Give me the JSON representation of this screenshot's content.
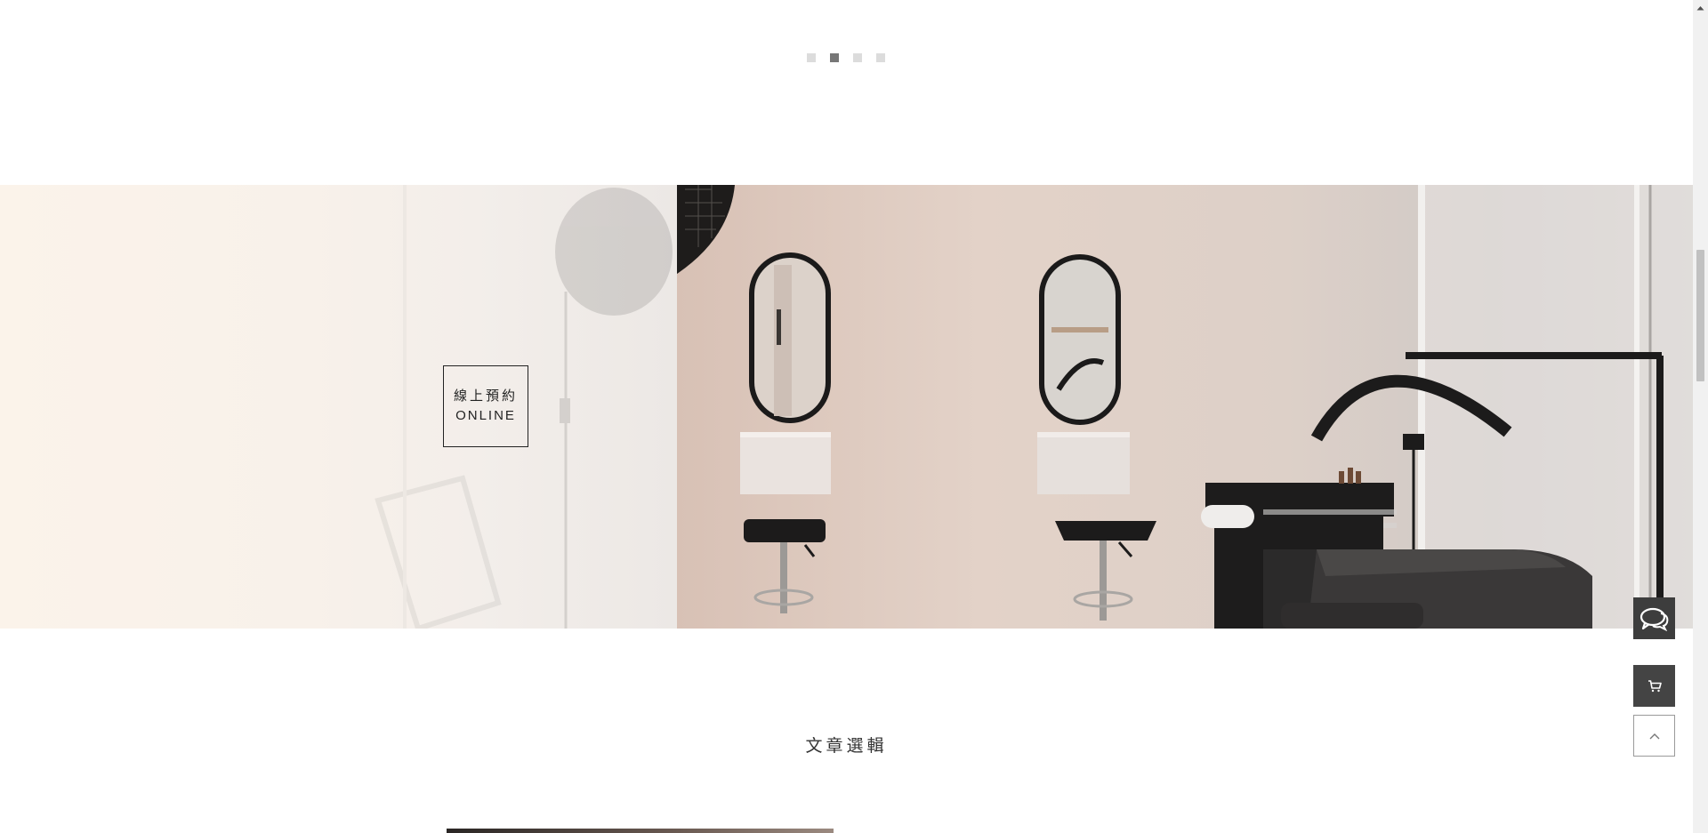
{
  "carousel": {
    "dots": [
      {
        "label": "slide-1",
        "active": false
      },
      {
        "label": "slide-2",
        "active": true
      },
      {
        "label": "slide-3",
        "active": false
      },
      {
        "label": "slide-4",
        "active": false
      }
    ]
  },
  "banner": {
    "booking_zh": "線上預約",
    "booking_en": "ONLINE"
  },
  "articles": {
    "title": "文章選輯"
  },
  "floating": {
    "chat_icon": "chat-bubbles-icon",
    "cart_icon": "cart-icon",
    "top_icon": "chevron-up-icon"
  },
  "colors": {
    "dot_active": "#777777",
    "dot_inactive": "#dcdcdc",
    "float_dark": "#3d3d3d"
  }
}
